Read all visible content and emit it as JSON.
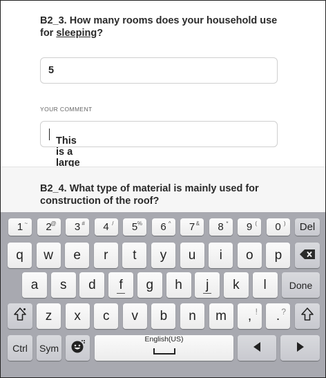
{
  "form": {
    "q1": {
      "prefix": "B2_3. How many rooms does your household use for ",
      "underlined": "sleeping",
      "suffix": "?",
      "answer": "5",
      "comment_label": "YOUR COMMENT",
      "comment": "This is a large house"
    },
    "q2": {
      "text": "B2_4. What type of material is mainly used for construction of the roof?"
    }
  },
  "keyboard": {
    "number_row": [
      {
        "label": "1",
        "sup": "~"
      },
      {
        "label": "2",
        "sup": "@"
      },
      {
        "label": "3",
        "sup": "#"
      },
      {
        "label": "4",
        "sup": "/"
      },
      {
        "label": "5",
        "sup": "%"
      },
      {
        "label": "6",
        "sup": "^"
      },
      {
        "label": "7",
        "sup": "&"
      },
      {
        "label": "8",
        "sup": "*"
      },
      {
        "label": "9",
        "sup": "("
      },
      {
        "label": "0",
        "sup": ")"
      }
    ],
    "del_label": "Del",
    "row1": [
      "q",
      "w",
      "e",
      "r",
      "t",
      "y",
      "u",
      "i",
      "o",
      "p"
    ],
    "row2": [
      "a",
      "s",
      "d",
      "f",
      "g",
      "h",
      "j",
      "k",
      "l"
    ],
    "done_label": "Done",
    "row3": [
      "z",
      "x",
      "c",
      "v",
      "b",
      "n",
      "m"
    ],
    "comma": ",",
    "comma_alt": "!",
    "period": ".",
    "period_alt": "?",
    "shift_icon": "shift-icon",
    "backspace_icon": "backspace-icon",
    "ctrl_label": "Ctrl",
    "sym_label": "Sym",
    "emoji_icon": "emoji-icon",
    "space_label": "English(US)",
    "left_icon": "arrow-left-icon",
    "right_icon": "arrow-right-icon"
  }
}
